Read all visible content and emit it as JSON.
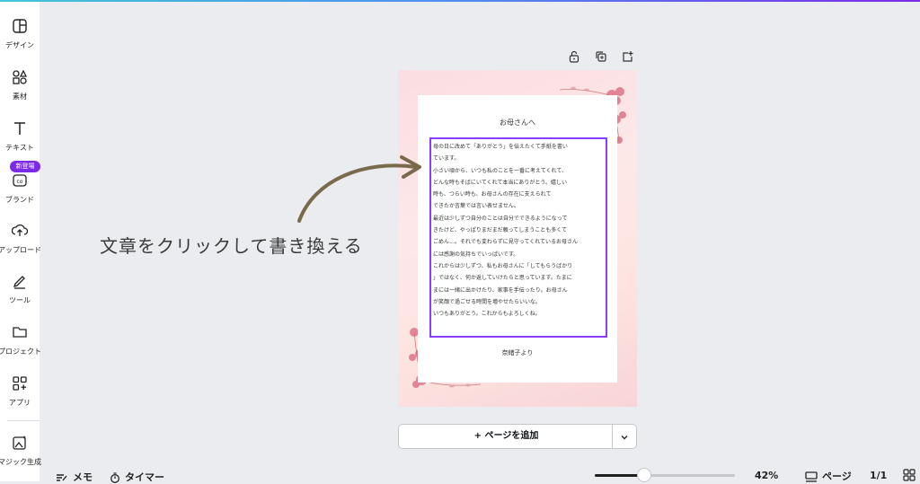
{
  "sidebar": {
    "items": [
      {
        "label": "デザイン",
        "icon": "design-icon"
      },
      {
        "label": "素材",
        "icon": "elements-icon"
      },
      {
        "label": "テキスト",
        "icon": "text-icon"
      },
      {
        "label": "ブランド",
        "icon": "brand-icon"
      },
      {
        "label": "アップロード",
        "icon": "upload-icon"
      },
      {
        "label": "ツール",
        "icon": "draw-icon"
      },
      {
        "label": "プロジェクト",
        "icon": "folder-icon"
      },
      {
        "label": "アプリ",
        "icon": "apps-icon"
      },
      {
        "label": "マジック生成",
        "icon": "magic-media-icon"
      }
    ],
    "new_badge": "新登場"
  },
  "canvas": {
    "toolbar_icons": [
      "lock-icon",
      "duplicate-icon",
      "add-page-icon"
    ],
    "letter": {
      "title": "お母さんへ",
      "lines": [
        "母の日に改めて「ありがとう」を伝えたくて手紙を書い",
        "ています。",
        "小さい頃から、いつも私のことを一番に考えてくれて、",
        "どんな時もそばにいてくれて本当にありがとう。嬉しい",
        "時も、つらい時も、お母さんの存在に支えられて",
        "できたか言葉では言い表せません。",
        "最近は少しずつ自分のことは自分でできるようになって",
        "きたけど、やっぱりまだまだ頼ってしまうことも多くて",
        "ごめん…。それでも変わらずに見守ってくれているお母さん",
        "には感謝の気持ちでいっぱいです。",
        "これからは少しずつ、私もお母さんに「してもらうばかり",
        "」ではなく、何か返していけたらと思っています。たまに",
        "まには一緒に出かけたり、家事を手伝ったり。お母さん",
        "が笑顔で過ごせる時間を増やせたらいいな。",
        "いつもありがとう。これからもよろしくね。"
      ],
      "signature": "奈緒子より"
    },
    "overlay_text": "文章をクリックして書き換える"
  },
  "add_page": {
    "label": "+ ページを追加"
  },
  "bottom_bar": {
    "notes_label": "メモ",
    "timer_label": "タイマー",
    "zoom_fraction": 0.35,
    "zoom_label": "42%",
    "pages_label": "ページ",
    "page_count": "1/1"
  },
  "colors": {
    "accent": "#8b3dff",
    "canvas_bg": "#ebecf0",
    "page_pink": "#fbdde1",
    "arrow": "#7a6a4c"
  }
}
